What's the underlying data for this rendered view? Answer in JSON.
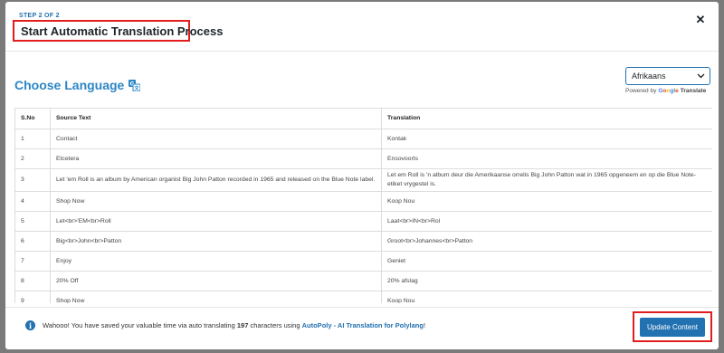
{
  "modal": {
    "step_label": "STEP 2 OF 2",
    "title": "Start Automatic Translation Process",
    "close_label": "✕"
  },
  "language": {
    "heading": "Choose Language",
    "selected": "Afrikaans",
    "powered_by": "Powered by",
    "google_letters": [
      "G",
      "o",
      "o",
      "g",
      "l",
      "e"
    ],
    "translate_label": "Translate"
  },
  "table": {
    "headers": [
      "S.No",
      "Source Text",
      "Translation"
    ],
    "rows": [
      {
        "no": "1",
        "source": "Contact",
        "translation": "Kontak"
      },
      {
        "no": "2",
        "source": "Etcetera",
        "translation": "Ensovoorts"
      },
      {
        "no": "3",
        "source": "Let 'em Roll is an album by American organist Big John Patton recorded in 1965 and released on the Blue Note label.",
        "translation": "Let em Roll is 'n album deur die Amerikaanse orrelis Big John Patton wat in 1965 opgeneem en op die Blue Note-etiket vrygestel is."
      },
      {
        "no": "4",
        "source": "Shop Now",
        "translation": "Koop Nou"
      },
      {
        "no": "5",
        "source": "Let<br>'EM<br>Roll",
        "translation": "Laat<br>IN<br>Rol"
      },
      {
        "no": "6",
        "source": "Big<br>John<br>Patton",
        "translation": "Groot<br>Johannes<br>Patton"
      },
      {
        "no": "7",
        "source": "Enjoy",
        "translation": "Geniet"
      },
      {
        "no": "8",
        "source": "20% Off",
        "translation": "20% afslag"
      },
      {
        "no": "9",
        "source": "Shop Now",
        "translation": "Koop Nou"
      }
    ]
  },
  "footer": {
    "msg_prefix": "Wahooo! You have saved your valuable time via auto translating",
    "char_count": "197",
    "msg_mid": "characters using",
    "link_text": "AutoPoly - AI Translation for Polylang",
    "msg_suffix": "!",
    "update_label": "Update Content"
  },
  "colors": {
    "accent": "#2271b1",
    "heading_blue": "#2b86c5",
    "highlight_red": "#e11d1d",
    "overlay": "#7a7a7a"
  },
  "icons": {
    "close": "close-icon",
    "translate": "translate-icon",
    "dropdown": "chevron-down-icon",
    "info": "info-icon"
  }
}
